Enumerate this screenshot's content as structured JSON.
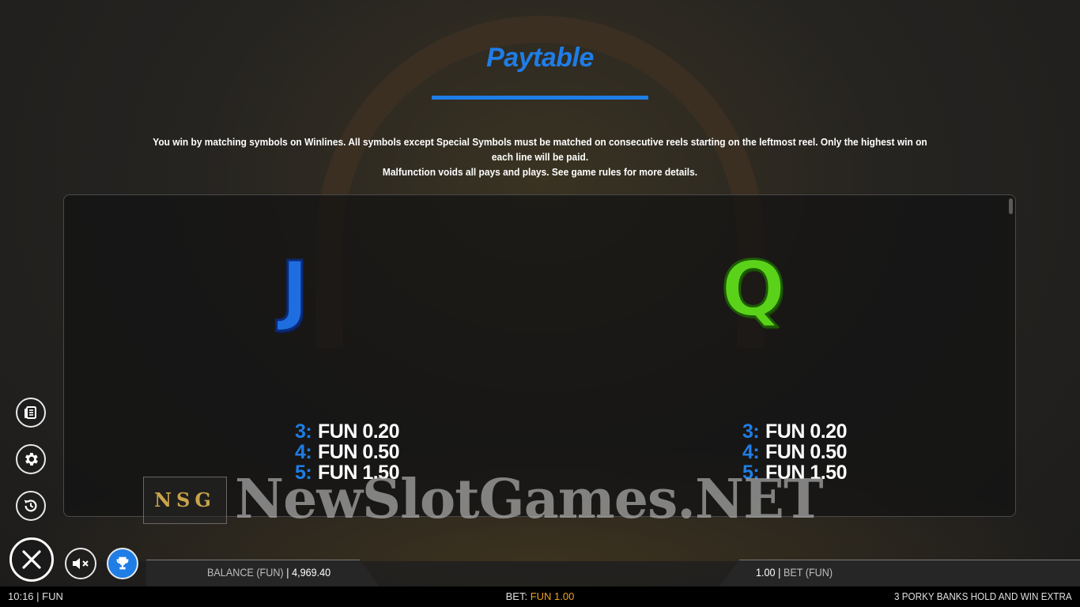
{
  "page": {
    "title": "Paytable",
    "intro_line1": "You win by matching symbols on Winlines. All symbols except Special Symbols must be matched on consecutive reels starting on the leftmost reel. Only the highest win on each line will be paid.",
    "intro_line2": "Malfunction voids all pays and plays. See game rules for more details."
  },
  "symbols": [
    {
      "letter": "J",
      "color": "#1e6ee0",
      "pays": [
        {
          "count": "3:",
          "value": "FUN 0.20"
        },
        {
          "count": "4:",
          "value": "FUN 0.50"
        },
        {
          "count": "5:",
          "value": "FUN 1.50"
        }
      ]
    },
    {
      "letter": "Q",
      "color": "#5bd21a",
      "pays": [
        {
          "count": "3:",
          "value": "FUN 0.20"
        },
        {
          "count": "4:",
          "value": "FUN 0.50"
        },
        {
          "count": "5:",
          "value": "FUN 1.50"
        }
      ]
    }
  ],
  "watermark": {
    "logo": "NSG",
    "text": "NewSlotGames.NET"
  },
  "side_buttons": [
    {
      "icon": "paytable-icon"
    },
    {
      "icon": "gear-icon"
    },
    {
      "icon": "history-icon"
    }
  ],
  "bottom": {
    "balance_label": "BALANCE (FUN)",
    "balance_sep": "|",
    "balance_value": "4,969.40",
    "bet_value": "1.00",
    "bet_sep": "|",
    "bet_label": "BET (FUN)"
  },
  "status": {
    "time": "10:16 | FUN",
    "bet_label": "BET:",
    "bet_amount": "FUN 1.00",
    "game_name": "3 PORKY BANKS HOLD AND WIN EXTRA"
  },
  "colors": {
    "accent": "#1f7de6",
    "bet_amount": "#f0a020"
  }
}
